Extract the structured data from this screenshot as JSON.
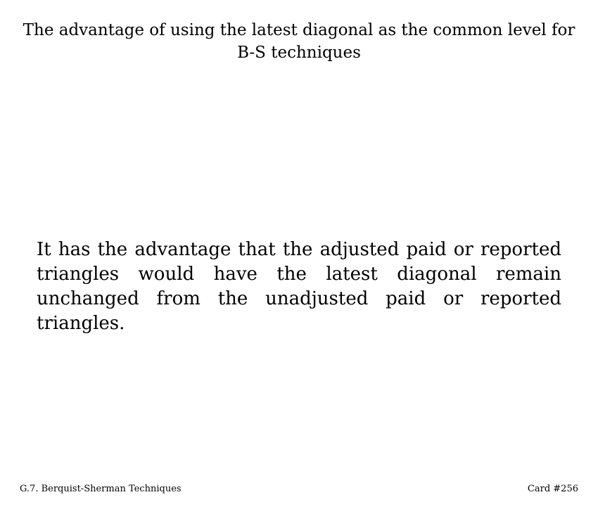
{
  "card": {
    "title": "The advantage of using the latest diagonal as the common level for B-S techniques",
    "body": "It has the advantage that the adjusted paid or reported triangles would have the latest diagonal remain unchanged from the unadjusted paid or reported triangles.",
    "footer": {
      "section": "G.7. Berquist-Sherman Techniques",
      "card_number": "Card #256"
    }
  }
}
